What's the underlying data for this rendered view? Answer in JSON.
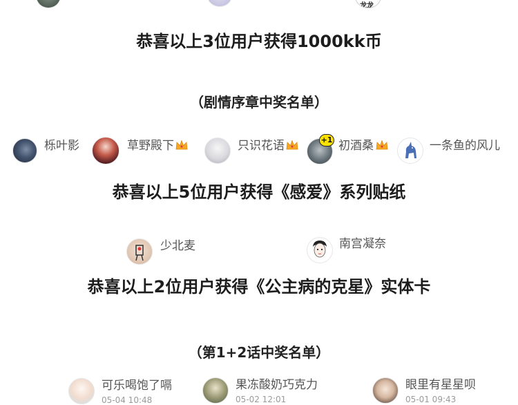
{
  "top_partial": {
    "name": "龙龙"
  },
  "headline_1": "恭喜以上3位用户获得1000kk币",
  "section_1": "（剧情序章中奖名单）",
  "row_1": [
    {
      "name": "栎叶影"
    },
    {
      "name": "草野殿下"
    },
    {
      "name": "只识花语"
    },
    {
      "name": "初酒桑",
      "badge": "+1"
    },
    {
      "name": "一条鱼的风儿"
    }
  ],
  "headline_2": "恭喜以上5位用户获得《感爱》系列贴纸",
  "row_2": [
    {
      "name": "少北麦"
    },
    {
      "name": "南宫凝奈"
    }
  ],
  "headline_3": "恭喜以上2位用户获得《公主病的克星》实体卡",
  "section_2": "（第1+2话中奖名单）",
  "row_3": [
    {
      "name": "可乐喝饱了嗝",
      "date": "05-04 10:48"
    },
    {
      "name": "果冻酸奶巧克力",
      "date": "05-02 12:01"
    },
    {
      "name": "眼里有星星呗",
      "date": "05-01 09:43"
    }
  ],
  "colors": {
    "crown": "#f5a623",
    "badge_yellow": "#ffe100"
  },
  "icons": [
    "crown-icon",
    "plus-one-badge"
  ]
}
